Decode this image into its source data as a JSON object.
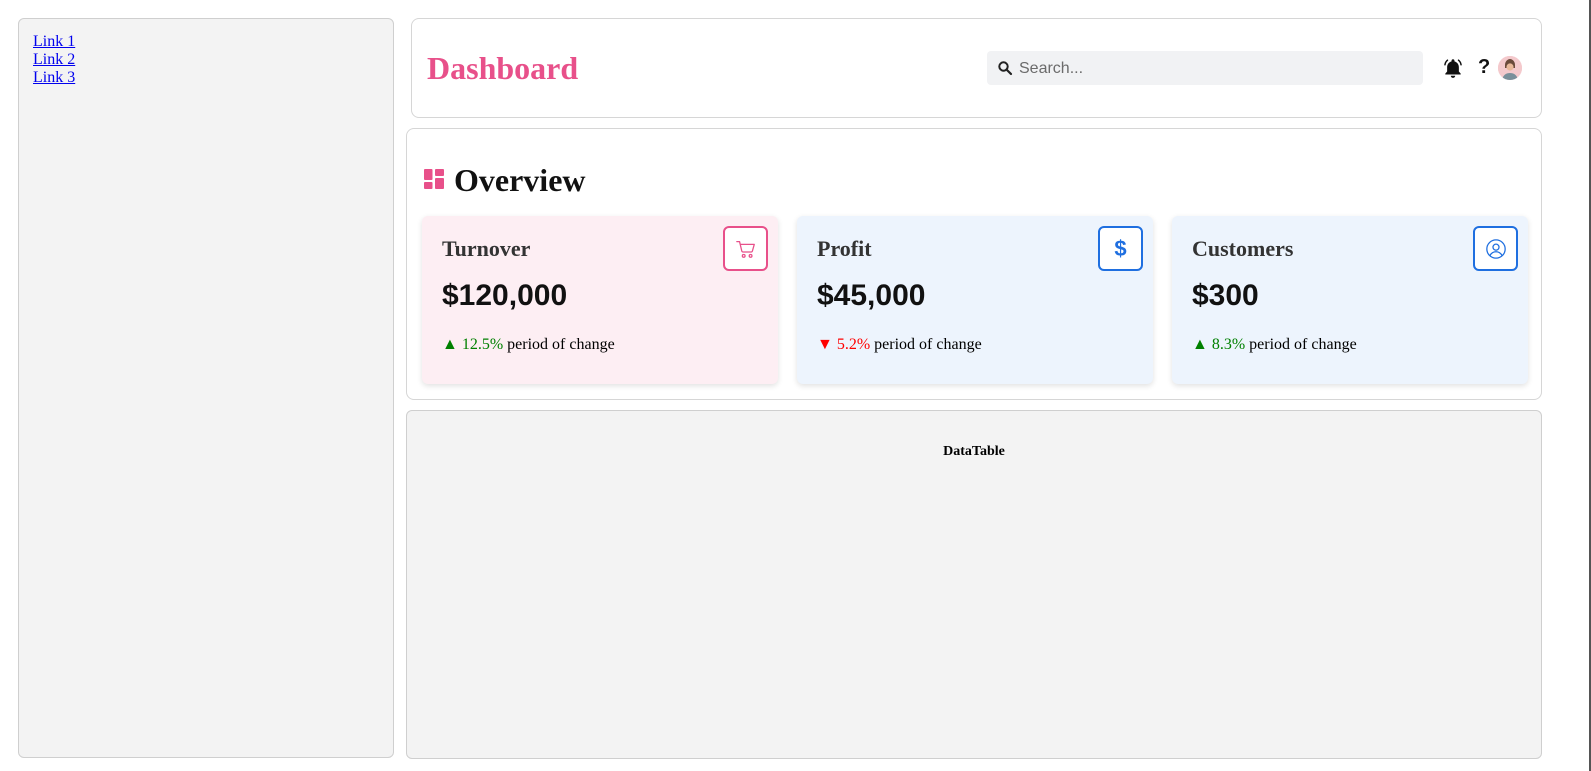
{
  "sidebar": {
    "links": [
      "Link 1",
      "Link 2",
      "Link 3"
    ]
  },
  "header": {
    "title": "Dashboard",
    "search_placeholder": "Search...",
    "help_label": "?"
  },
  "overview": {
    "title": "Overview",
    "cards": [
      {
        "title": "Turnover",
        "value": "$120,000",
        "direction": "up",
        "arrow": "▲",
        "change": "12.5%",
        "change_suffix": "period of change",
        "icon": "cart-icon",
        "bg_color": "#fdeef3",
        "accent_color": "#e8508a",
        "change_color": "#008000"
      },
      {
        "title": "Profit",
        "value": "$45,000",
        "direction": "down",
        "arrow": "▼",
        "change": "5.2%",
        "change_suffix": "period of change",
        "icon": "dollar-icon",
        "bg_color": "#edf4fd",
        "accent_color": "#1f6fe0",
        "change_color": "#ff0000"
      },
      {
        "title": "Customers",
        "value": "$300",
        "direction": "up",
        "arrow": "▲",
        "change": "8.3%",
        "change_suffix": "period of change",
        "icon": "user-icon",
        "bg_color": "#edf4fd",
        "accent_color": "#1f6fe0",
        "change_color": "#008000"
      }
    ]
  },
  "datatable": {
    "label": "DataTable"
  },
  "colors": {
    "brand": "#e8508a",
    "up": "#008000",
    "down": "#ff0000",
    "link": "#0000ee"
  }
}
